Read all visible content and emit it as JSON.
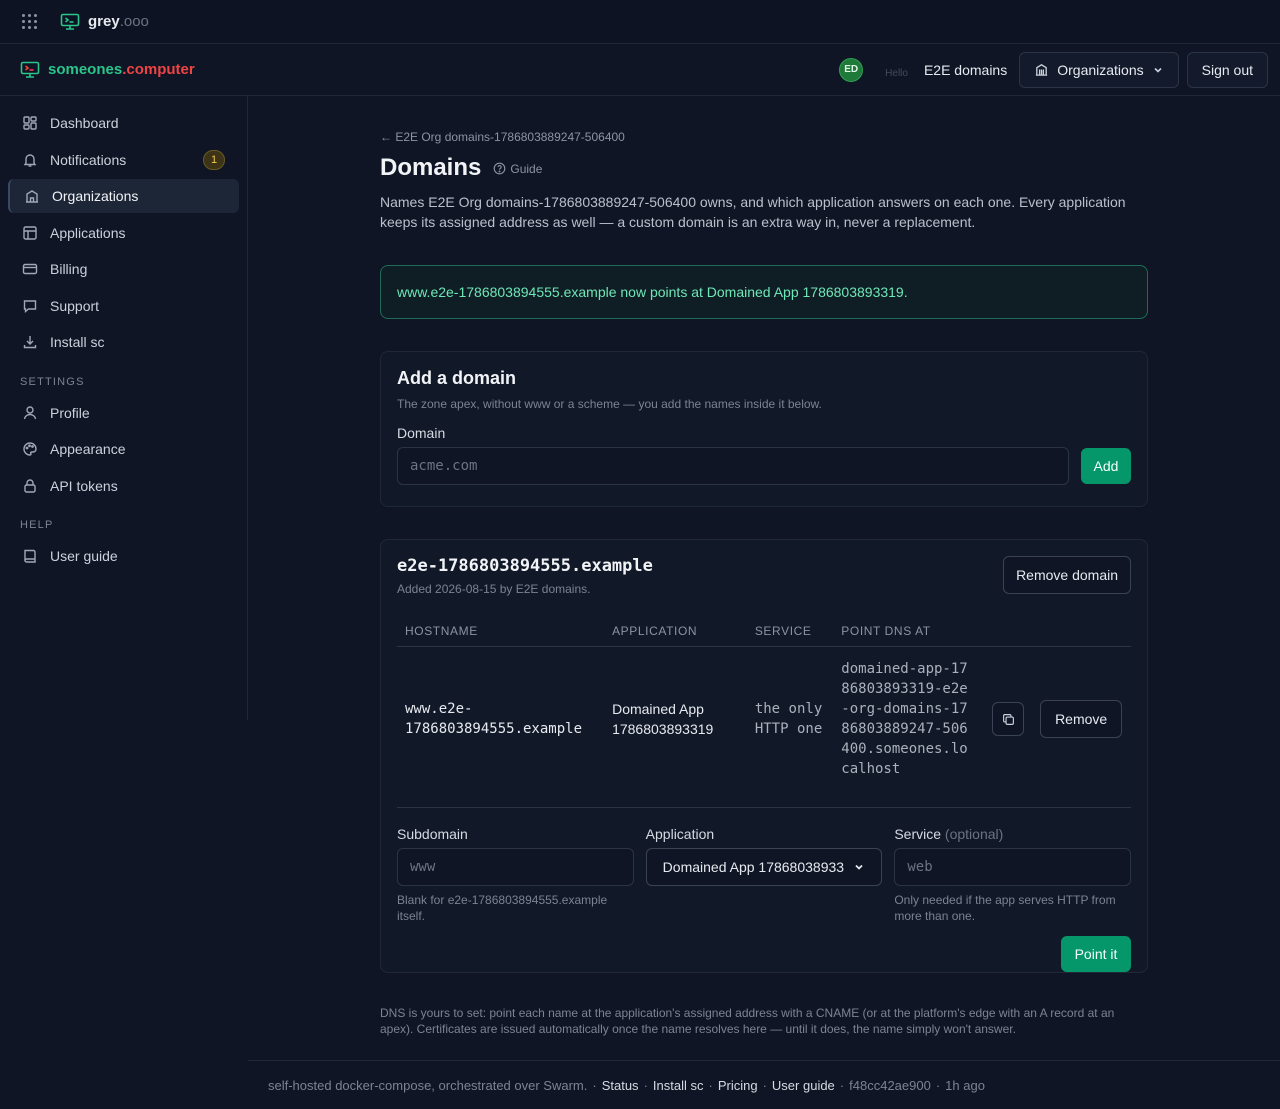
{
  "topbar": {
    "brand_main": "grey",
    "brand_dim": ".ooo"
  },
  "app": {
    "brand_left": "someones",
    "brand_right": ".computer"
  },
  "header": {
    "avatar_initials": "ED",
    "hello": "Hello",
    "user_name": "E2E domains",
    "orgs_label": "Organizations",
    "signout_label": "Sign out"
  },
  "sidebar": {
    "items": [
      {
        "label": "Dashboard",
        "icon": "dashboard-icon"
      },
      {
        "label": "Notifications",
        "icon": "bell-icon",
        "badge": "1"
      },
      {
        "label": "Organizations",
        "icon": "building-icon",
        "active": true
      },
      {
        "label": "Applications",
        "icon": "layout-icon"
      },
      {
        "label": "Billing",
        "icon": "card-icon"
      },
      {
        "label": "Support",
        "icon": "chat-icon"
      },
      {
        "label": "Install sc",
        "icon": "download-icon"
      }
    ],
    "settings_header": "SETTINGS",
    "settings": [
      {
        "label": "Profile",
        "icon": "user-icon"
      },
      {
        "label": "Appearance",
        "icon": "palette-icon"
      },
      {
        "label": "API tokens",
        "icon": "lock-icon"
      }
    ],
    "help_header": "HELP",
    "help": [
      {
        "label": "User guide",
        "icon": "book-icon"
      }
    ]
  },
  "page": {
    "back_link": "← E2E Org domains-1786803889247-506400",
    "title": "Domains",
    "guide_label": "Guide",
    "intro": "Names E2E Org domains-1786803889247-506400 owns, and which application answers on each one. Every application keeps its assigned address as well — a custom domain is an extra way in, never a replacement.",
    "notice": "www.e2e-1786803894555.example now points at Domained App 1786803893319."
  },
  "add_domain": {
    "title": "Add a domain",
    "help": "The zone apex, without www or a scheme — you add the names inside it below.",
    "field_label": "Domain",
    "placeholder": "acme.com",
    "button": "Add"
  },
  "domain_card": {
    "name": "e2e-1786803894555.example",
    "added": "Added 2026-08-15 by E2E domains.",
    "remove_domain": "Remove domain",
    "columns": [
      "HOSTNAME",
      "APPLICATION",
      "SERVICE",
      "POINT DNS AT"
    ],
    "rows": [
      {
        "hostname": "www.e2e-1786803894555.example",
        "application": "Domained App 1786803893319",
        "service": "the only HTTP one",
        "point_dns": "domained-app-1786803893319-e2e-org-domains-1786803889247-506400.someones.localhost",
        "remove": "Remove"
      }
    ],
    "form": {
      "subdomain_label": "Subdomain",
      "subdomain_placeholder": "www",
      "subdomain_hint": "Blank for e2e-1786803894555.example itself.",
      "application_label": "Application",
      "application_value": "Domained App 17868038933",
      "service_label": "Service",
      "service_optional": "(optional)",
      "service_placeholder": "web",
      "service_hint": "Only needed if the app serves HTTP from more than one.",
      "submit": "Point it"
    }
  },
  "footnote": "DNS is yours to set: point each name at the application's assigned address with a CNAME (or at the platform's edge with an A record at an apex). Certificates are issued automatically once the name resolves here — until it does, the name simply won't answer.",
  "footer": {
    "text": "self-hosted docker-compose, orchestrated over Swarm.",
    "links": [
      "Status",
      "Install sc",
      "Pricing",
      "User guide"
    ],
    "commit": "f48cc42ae900",
    "age": "1h ago"
  },
  "colors": {
    "accent_green": "#059669",
    "brand_green": "#2bc48a",
    "brand_red": "#ef4444",
    "notice_text": "#6ee7b7"
  }
}
